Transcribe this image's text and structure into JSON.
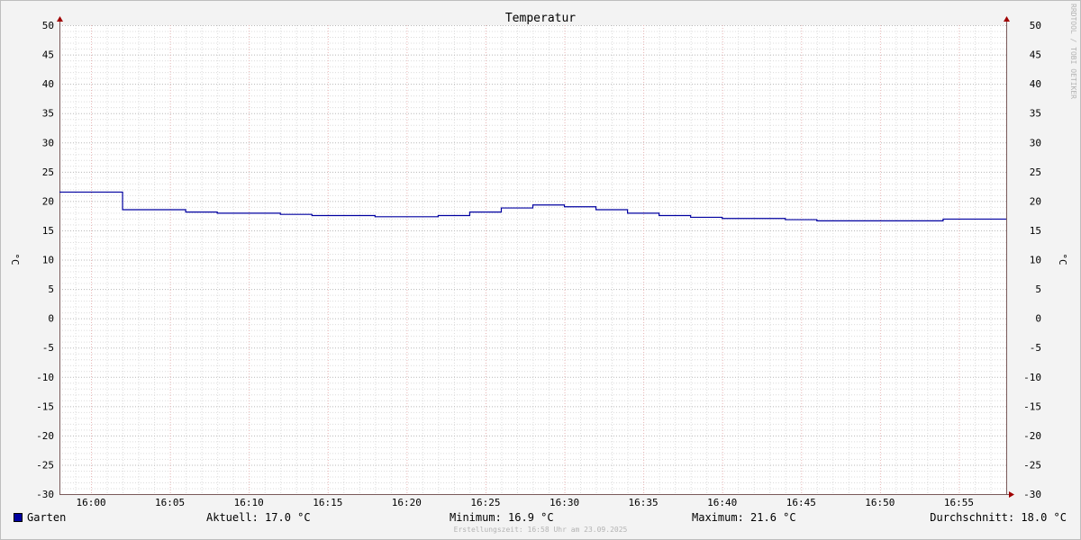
{
  "chart_data": {
    "type": "line",
    "title": "Temperatur",
    "ylabel": "°C",
    "ylabel_right": "°C",
    "ylim": [
      -30,
      50
    ],
    "y_ticks": [
      50,
      45,
      40,
      35,
      30,
      25,
      20,
      15,
      10,
      5,
      0,
      -5,
      -10,
      -15,
      -20,
      -25,
      -30
    ],
    "x_start": "15:58",
    "x_end": "16:58",
    "x_ticks": [
      "16:00",
      "16:05",
      "16:10",
      "16:15",
      "16:20",
      "16:25",
      "16:30",
      "16:35",
      "16:40",
      "16:45",
      "16:50",
      "16:55"
    ],
    "grid": true,
    "legend_position": "bottom-left",
    "series": [
      {
        "name": "Garten",
        "color": "#0000a0",
        "step": true,
        "points": [
          [
            "15:58",
            21.6
          ],
          [
            "16:02",
            18.6
          ],
          [
            "16:06",
            18.2
          ],
          [
            "16:08",
            18.0
          ],
          [
            "16:12",
            17.8
          ],
          [
            "16:14",
            17.6
          ],
          [
            "16:18",
            17.4
          ],
          [
            "16:22",
            17.6
          ],
          [
            "16:24",
            18.2
          ],
          [
            "16:26",
            18.9
          ],
          [
            "16:28",
            19.4
          ],
          [
            "16:30",
            19.1
          ],
          [
            "16:32",
            18.6
          ],
          [
            "16:34",
            18.0
          ],
          [
            "16:36",
            17.6
          ],
          [
            "16:38",
            17.3
          ],
          [
            "16:40",
            17.1
          ],
          [
            "16:44",
            16.9
          ],
          [
            "16:46",
            16.7
          ],
          [
            "16:54",
            17.0
          ],
          [
            "16:58",
            17.0
          ]
        ]
      }
    ]
  },
  "legend": {
    "series_name": "Garten",
    "swatch_color": "#0000a0"
  },
  "stats": {
    "current": "Aktuell: 17.0 °C",
    "minimum": "Minimum: 16.9 °C",
    "maximum": "Maximum: 21.6 °C",
    "average": "Durchschnitt: 18.0 °C"
  },
  "footer": "Erstellungszeit: 16:58 Uhr am 23.09.2025",
  "watermark": "RRDTOOL / TOBI OETIKER",
  "colors": {
    "background": "#f3f3f3",
    "plot_background": "#ffffff",
    "grid_minor": "#dcdcdc",
    "grid_major": "#e8b4b4",
    "axis": "#7a5a5a",
    "line": "#0000a0"
  }
}
